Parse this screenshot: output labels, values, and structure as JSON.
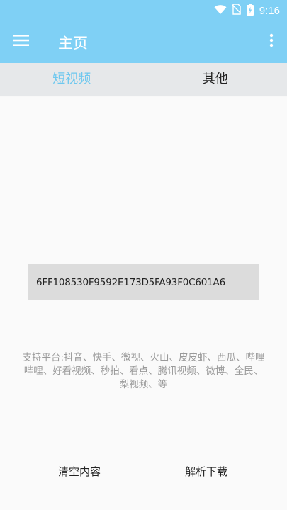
{
  "status_bar": {
    "time": "9:16",
    "icons": [
      "wifi-icon",
      "no-sim-icon",
      "battery-icon"
    ]
  },
  "app_bar": {
    "title": "主页",
    "menu_icon": "hamburger-menu-icon",
    "overflow_icon": "more-vert-icon"
  },
  "tabs": [
    {
      "label": "短视频",
      "active": true
    },
    {
      "label": "其他",
      "active": false
    }
  ],
  "input": {
    "value": "6FF108530F9592E173D5FA93F0C601A6"
  },
  "support_text": "支持平台:抖音、快手、微视、火山、皮皮虾、西瓜、哔哩哔哩、好看视频、秒拍、看点、腾讯视频、微博、全民、梨视频、等",
  "buttons": {
    "clear": "清空内容",
    "parse": "解析下载"
  },
  "colors": {
    "primary": "#7fd0f5",
    "tab_active": "#6ec8ef",
    "tab_bar_bg": "#e6e8ea",
    "input_bg": "#dcdcdc",
    "hint_text": "#9a9a9a"
  }
}
